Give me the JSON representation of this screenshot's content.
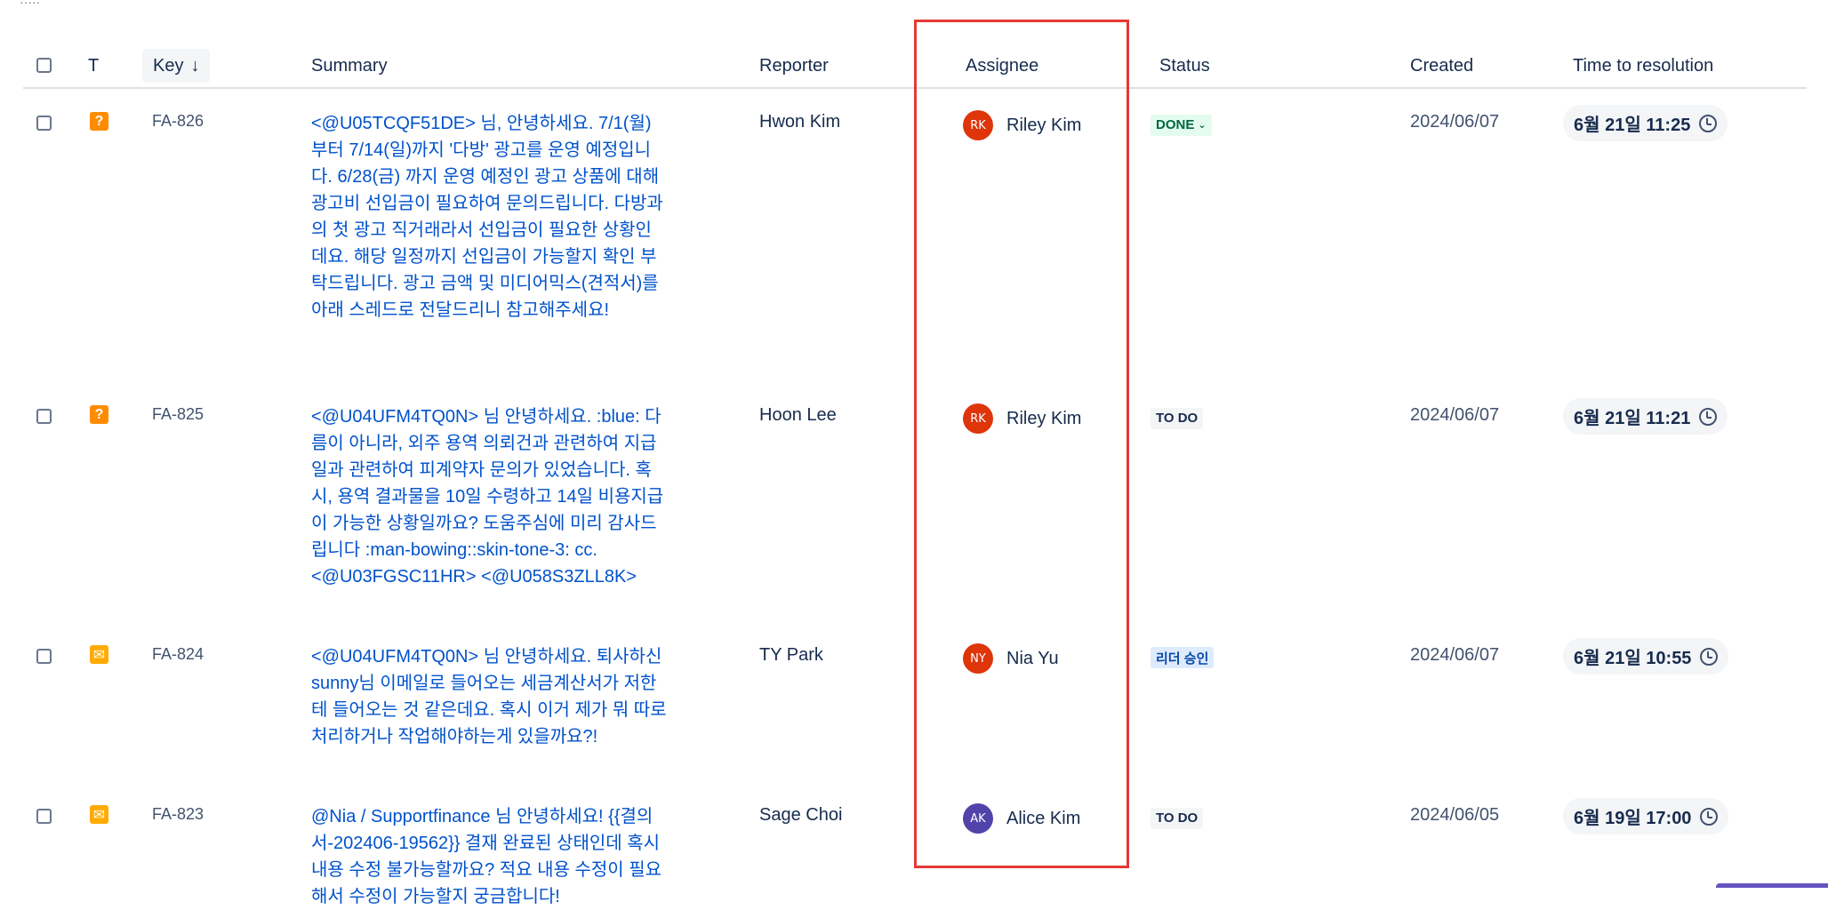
{
  "top_fragment": "·····",
  "columns": {
    "type": "T",
    "key": "Key",
    "summary": "Summary",
    "reporter": "Reporter",
    "assignee": "Assignee",
    "status": "Status",
    "created": "Created",
    "time_to_resolution": "Time to resolution"
  },
  "rows": [
    {
      "type_icon": "question-icon",
      "type_glyph": "?",
      "key": "FA-826",
      "summary": "<@U05TCQF51DE> 님, 안녕하세요. 7/1(월)부터 7/14(일)까지 '다방' 광고를 운영 예정입니다. 6/28(금) 까지 운영 예정인 광고 상품에 대해 광고비 선입금이 필요하여 문의드립니다. 다방과의 첫 광고 직거래라서 선입금이 필요한 상황인데요. 해당 일정까지 선입금이 가능할지 확인 부탁드립니다. 광고 금액 및 미디어믹스(견적서)를 아래 스레드로 전달드리니 참고해주세요!",
      "reporter": "Hwon Kim",
      "assignee_initials": "RK",
      "assignee_name": "Riley Kim",
      "assignee_color": "#de350b",
      "status": "DONE",
      "status_kind": "done",
      "created": "2024/06/07",
      "ttr": "6월 21일 11:25"
    },
    {
      "type_icon": "question-icon",
      "type_glyph": "?",
      "key": "FA-825",
      "summary": "<@U04UFM4TQ0N> 님 안녕하세요. :blue: 다름이 아니라, 외주 용역 의뢰건과 관련하여 지급일과 관련하여 피계약자 문의가 있었습니다. 혹시, 용역 결과물을 10일 수령하고 14일 비용지급이 가능한 상황일까요? 도움주심에 미리 감사드립니다 :man-bowing::skin-tone-3: cc. <@U03FGSC11HR> <@U058S3ZLL8K>",
      "reporter": "Hoon Lee",
      "assignee_initials": "RK",
      "assignee_name": "Riley Kim",
      "assignee_color": "#de350b",
      "status": "TO DO",
      "status_kind": "todo",
      "created": "2024/06/07",
      "ttr": "6월 21일 11:21"
    },
    {
      "type_icon": "email-icon",
      "type_glyph": "✉",
      "key": "FA-824",
      "summary": "<@U04UFM4TQ0N> 님 안녕하세요. 퇴사하신 sunny님 이메일로 들어오는 세금계산서가 저한테 들어오는 것 같은데요. 혹시 이거 제가 뭐 따로 처리하거나 작업해야하는게 있을까요?!",
      "reporter": "TY Park",
      "assignee_initials": "NY",
      "assignee_name": "Nia Yu",
      "assignee_color": "#de350b",
      "status": "리더 승인",
      "status_kind": "lead",
      "created": "2024/06/07",
      "ttr": "6월 21일 10:55"
    },
    {
      "type_icon": "email-icon",
      "type_glyph": "✉",
      "key": "FA-823",
      "summary": "@Nia / Supportfinance 님 안녕하세요! {{결의서-202406-19562}} 결재 완료된 상태인데 혹시 내용 수정 불가능할까요? 적요 내용 수정이 필요해서 수정이 가능할지 궁금합니다!",
      "reporter": "Sage Choi",
      "assignee_initials": "AK",
      "assignee_name": "Alice Kim",
      "assignee_color": "#5243aa",
      "status": "TO DO",
      "status_kind": "todo",
      "created": "2024/06/05",
      "ttr": "6월 19일 17:00"
    }
  ]
}
